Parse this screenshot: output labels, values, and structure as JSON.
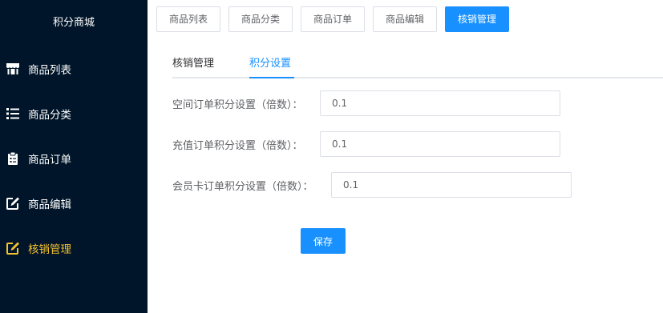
{
  "sidebar": {
    "title": "积分商城",
    "items": [
      {
        "label": "商品列表",
        "icon": "store-icon"
      },
      {
        "label": "商品分类",
        "icon": "list-icon"
      },
      {
        "label": "商品订单",
        "icon": "clipboard-icon"
      },
      {
        "label": "商品编辑",
        "icon": "edit-icon"
      },
      {
        "label": "核销管理",
        "icon": "edit-icon"
      }
    ],
    "active_index": 4,
    "active_color": "#f5c130"
  },
  "top_tabs": [
    {
      "label": "商品列表"
    },
    {
      "label": "商品分类"
    },
    {
      "label": "商品订单"
    },
    {
      "label": "商品编辑"
    },
    {
      "label": "核销管理"
    }
  ],
  "sub_tabs": [
    {
      "label": "核销管理"
    },
    {
      "label": "积分设置"
    }
  ],
  "form": {
    "fields": [
      {
        "label": "空间订单积分设置（倍数）：",
        "value": "0.1"
      },
      {
        "label": "充值订单积分设置（倍数）：",
        "value": "0.1"
      },
      {
        "label": "会员卡订单积分设置（倍数）：",
        "value": "0.1"
      }
    ],
    "save_label": "保存"
  },
  "colors": {
    "sidebar_bg": "#001529",
    "primary": "#1890ff"
  }
}
